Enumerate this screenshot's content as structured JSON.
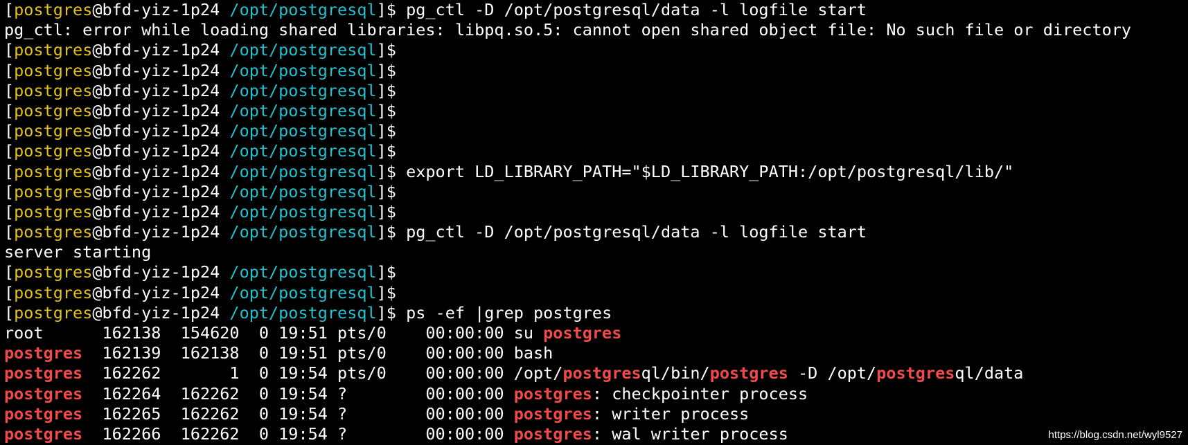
{
  "terminal": {
    "colors": {
      "background": "#000000",
      "default": "#ffffff",
      "prompt_user": "#e3c219",
      "prompt_path": "#22c1cf",
      "grep_match": "#f24a4a"
    },
    "prompt": {
      "open_bracket": "[",
      "user": "postgres",
      "at_host": "@bfd-yiz-1p24 ",
      "path": "/opt/postgresql",
      "close": "]$"
    },
    "lines": [
      {
        "type": "prompt",
        "command": " pg_ctl -D /opt/postgresql/data -l logfile start"
      },
      {
        "type": "output",
        "segments": [
          {
            "text": "pg_ctl: error while loading shared libraries: libpq.so.5: cannot open shared object file: No such file or directory",
            "style": "white"
          }
        ]
      },
      {
        "type": "prompt",
        "command": ""
      },
      {
        "type": "prompt",
        "command": ""
      },
      {
        "type": "prompt",
        "command": ""
      },
      {
        "type": "prompt",
        "command": ""
      },
      {
        "type": "prompt",
        "command": ""
      },
      {
        "type": "prompt",
        "command": ""
      },
      {
        "type": "prompt",
        "command": " export LD_LIBRARY_PATH=\"$LD_LIBRARY_PATH:/opt/postgresql/lib/\""
      },
      {
        "type": "prompt",
        "command": ""
      },
      {
        "type": "prompt",
        "command": ""
      },
      {
        "type": "prompt",
        "command": " pg_ctl -D /opt/postgresql/data -l logfile start"
      },
      {
        "type": "output",
        "segments": [
          {
            "text": "server starting",
            "style": "white"
          }
        ]
      },
      {
        "type": "prompt",
        "command": ""
      },
      {
        "type": "prompt",
        "command": ""
      },
      {
        "type": "prompt",
        "command": " ps -ef |grep postgres"
      },
      {
        "type": "output",
        "segments": [
          {
            "text": "root      162138  154620  0 19:51 pts/0    00:00:00 su ",
            "style": "white"
          },
          {
            "text": "postgres",
            "style": "red"
          }
        ]
      },
      {
        "type": "output",
        "segments": [
          {
            "text": "postgres",
            "style": "red"
          },
          {
            "text": "  162139  162138  0 19:51 pts/0    00:00:00 bash",
            "style": "white"
          }
        ]
      },
      {
        "type": "output",
        "segments": [
          {
            "text": "postgres",
            "style": "red"
          },
          {
            "text": "  162262       1  0 19:54 pts/0    00:00:00 /opt/",
            "style": "white"
          },
          {
            "text": "postgres",
            "style": "red"
          },
          {
            "text": "ql/bin/",
            "style": "white"
          },
          {
            "text": "postgres",
            "style": "red"
          },
          {
            "text": " -D /opt/",
            "style": "white"
          },
          {
            "text": "postgres",
            "style": "red"
          },
          {
            "text": "ql/data",
            "style": "white"
          }
        ]
      },
      {
        "type": "output",
        "segments": [
          {
            "text": "postgres",
            "style": "red"
          },
          {
            "text": "  162264  162262  0 19:54 ?        00:00:00 ",
            "style": "white"
          },
          {
            "text": "postgres",
            "style": "red"
          },
          {
            "text": ": checkpointer process",
            "style": "white"
          }
        ]
      },
      {
        "type": "output",
        "segments": [
          {
            "text": "postgres",
            "style": "red"
          },
          {
            "text": "  162265  162262  0 19:54 ?        00:00:00 ",
            "style": "white"
          },
          {
            "text": "postgres",
            "style": "red"
          },
          {
            "text": ": writer process",
            "style": "white"
          }
        ]
      },
      {
        "type": "output",
        "segments": [
          {
            "text": "postgres",
            "style": "red"
          },
          {
            "text": "  162266  162262  0 19:54 ?        00:00:00 ",
            "style": "white"
          },
          {
            "text": "postgres",
            "style": "red"
          },
          {
            "text": ": wal writer process",
            "style": "white"
          }
        ]
      }
    ]
  },
  "watermark": "https://blog.csdn.net/wyl9527"
}
